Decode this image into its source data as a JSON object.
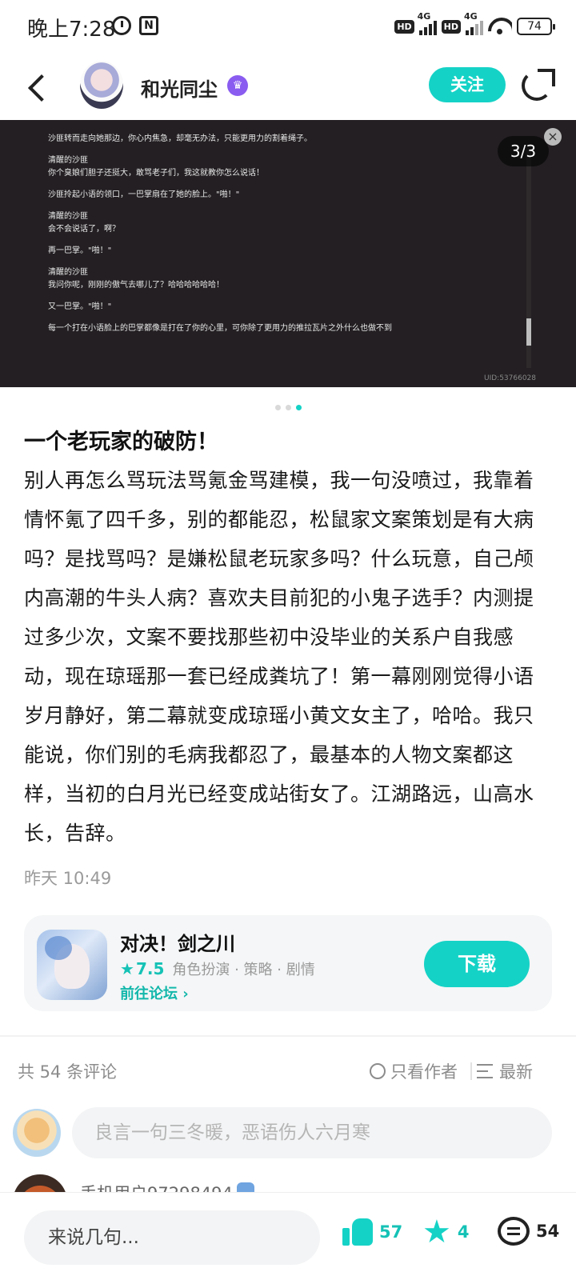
{
  "status_bar": {
    "time": "晚上7:28",
    "net1": "4G",
    "net2": "4G",
    "hd": "HD",
    "battery": "74",
    "nfc": "N"
  },
  "header": {
    "username": "和光同尘",
    "follow_label": "关注"
  },
  "carousel": {
    "counter": "3/3",
    "uid": "UID:53766028",
    "lines": [
      "沙匪转而走向她那边，你心内焦急，却毫无办法，只能更用力的割着绳子。",
      "清醒的沙匪\n你个臭娘们胆子还挺大，敢骂老子们，我这就教你怎么说话！",
      "沙匪拎起小语的领口，一巴掌扇在了她的脸上。\"啪！\"",
      "清醒的沙匪\n会不会说话了，啊？",
      "再一巴掌。\"啪！\"",
      "清醒的沙匪\n我问你呢，刚刚的傲气去哪儿了？哈哈哈哈哈哈！",
      "又一巴掌。\"啪！\"",
      "每一个打在小语脸上的巴掌都像是打在了你的心里，可你除了更用力的推拉瓦片之外什么也做不到"
    ]
  },
  "post": {
    "title": "一个老玩家的破防！",
    "body": "别人再怎么骂玩法骂氪金骂建模，我一句没喷过，我靠着情怀氪了四千多，别的都能忍，松鼠家文案策划是有大病吗？是找骂吗？是嫌松鼠老玩家多吗？什么玩意，自己颅内高潮的牛头人病？喜欢夫目前犯的小鬼子选手？内测提过多少次，文案不要找那些初中没毕业的关系户自我感动，现在琼瑶那一套已经成粪坑了！第一幕刚刚觉得小语岁月静好，第二幕就变成琼瑶小黄文女主了，哈哈。我只能说，你们别的毛病我都忍了，最基本的人物文案都这样，当初的白月光已经变成站街女了。江湖路远，山高水长，告辞。",
    "time": "昨天 10:49"
  },
  "game_card": {
    "name": "对决！剑之川",
    "rating": "7.5",
    "tags": "角色扮演 · 策略 · 剧情",
    "forum_link": "前往论坛",
    "download_label": "下载"
  },
  "comments": {
    "count_label": "共 54 条评论",
    "only_author": "只看作者",
    "sort_label": "最新",
    "input_placeholder": "良言一句三冬暖，恶语伤人六月寒",
    "peek_user": "手机用户97298494"
  },
  "bottom_bar": {
    "say_placeholder": "来说几句...",
    "likes": "57",
    "favorites": "4",
    "comments": "54"
  },
  "colors": {
    "accent": "#15d2c6",
    "badge": "#8a5cf0",
    "dark_panel": "#231f22"
  }
}
